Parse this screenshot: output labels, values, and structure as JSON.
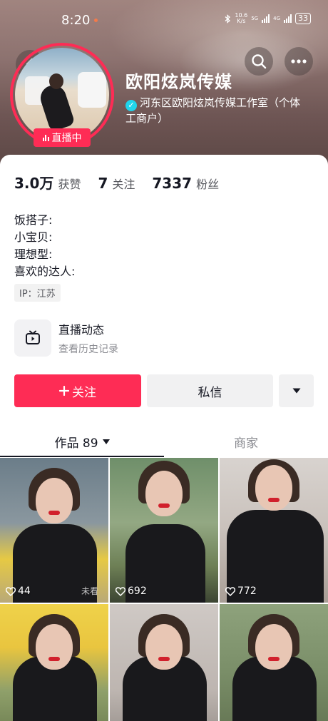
{
  "status_bar": {
    "time": "8:20",
    "net_speed_top": "10.6",
    "net_speed_bottom": "K/s",
    "signal1_label": "5G",
    "signal2_label": "4G",
    "battery": "33"
  },
  "profile": {
    "name": "欧阳炫岚传媒",
    "verification": "河东区欧阳炫岚传媒工作室（个体工商户）",
    "live_badge": "直播中"
  },
  "stats": [
    {
      "value": "3.0万",
      "label": "获赞"
    },
    {
      "value": "7",
      "label": "关注"
    },
    {
      "value": "7337",
      "label": "粉丝"
    }
  ],
  "bio_lines": [
    "饭搭子:",
    "小宝贝:",
    "理想型:",
    "喜欢的达人:"
  ],
  "ip_tag": "IP：江苏",
  "live_entry": {
    "title": "直播动态",
    "subtitle": "查看历史记录"
  },
  "actions": {
    "follow": "关注",
    "message": "私信"
  },
  "tabs": {
    "works_label": "作品 89",
    "shop_label": "商家"
  },
  "videos": [
    {
      "likes": "44",
      "watermark": "未看"
    },
    {
      "likes": "692",
      "watermark": ""
    },
    {
      "likes": "772",
      "watermark": ""
    },
    {
      "likes": "",
      "watermark": ""
    },
    {
      "likes": "",
      "watermark": ""
    },
    {
      "likes": "",
      "watermark": ""
    }
  ],
  "colors": {
    "accent": "#fe2c55",
    "verify": "#20d5ec",
    "text": "#161823",
    "muted": "#57585e"
  },
  "icons": {
    "back": "chevron-left-icon",
    "search": "search-icon",
    "more": "more-dots-icon",
    "tv": "tv-icon",
    "heart": "heart-outline-icon",
    "dropdown": "triangle-down-icon"
  }
}
